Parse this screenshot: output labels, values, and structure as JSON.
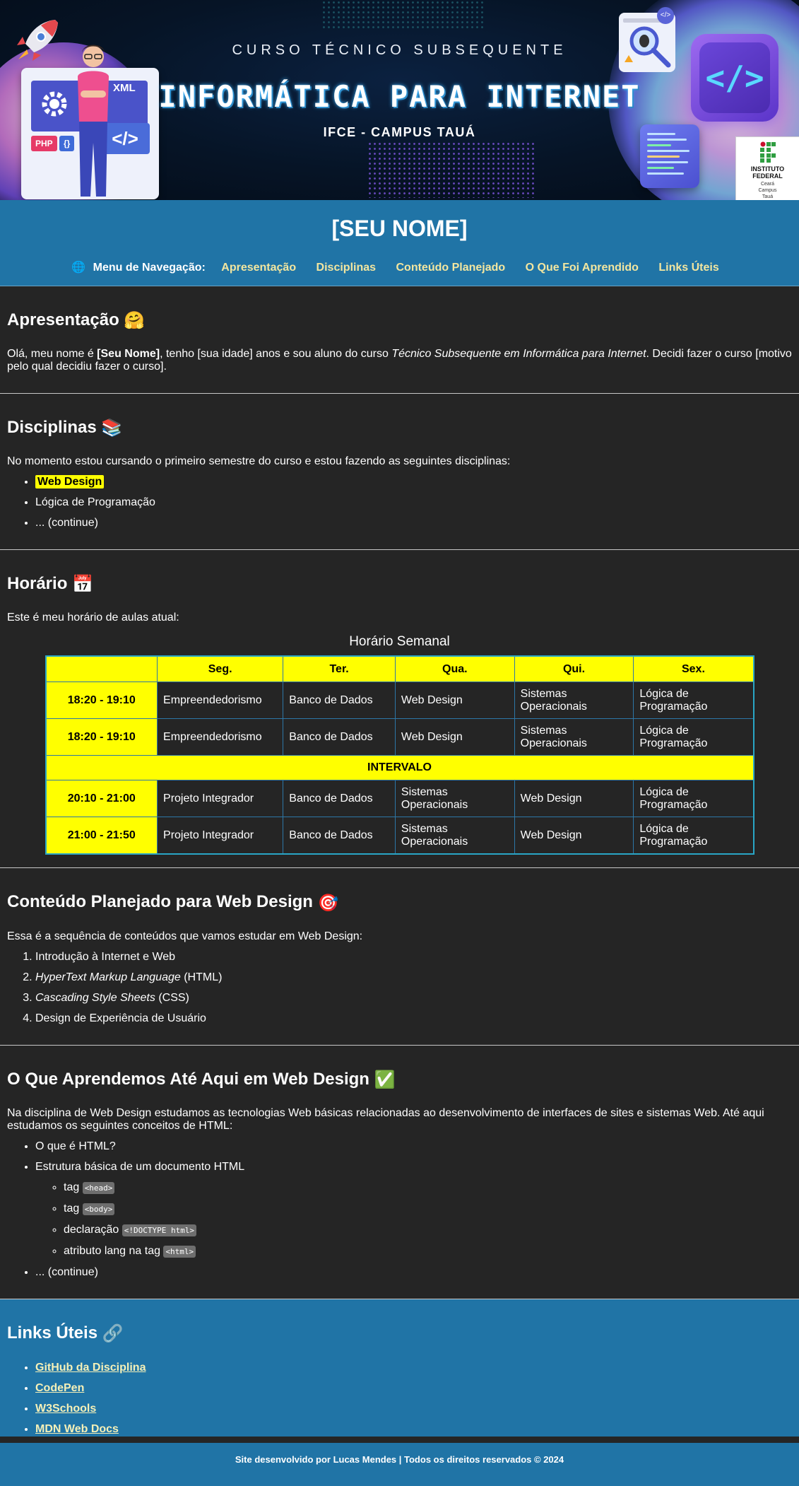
{
  "hero": {
    "subtitle": "CURSO TÉCNICO SUBSEQUENTE",
    "title": "INFORMÁTICA PARA INTERNET",
    "campus": "IFCE - CAMPUS TAUÁ",
    "board_xml": "XML",
    "board_php": "PHP",
    "board_braces": "{}",
    "board_code": "</>",
    "code_cube": "</>",
    "logo_line1": "INSTITUTO",
    "logo_line2": "FEDERAL",
    "logo_line3": "Ceará",
    "logo_line4": "Campus",
    "logo_line5": "Tauá"
  },
  "header": {
    "name": "[SEU NOME]",
    "nav_label": "Menu de Navegação:",
    "nav_items": [
      "Apresentação",
      "Disciplinas",
      "Conteúdo Planejado",
      "O Que Foi Aprendido",
      "Links Úteis"
    ]
  },
  "apresentacao": {
    "title": "Apresentação",
    "text_1": "Olá, meu nome é ",
    "name_bold": "[Seu Nome]",
    "text_2": ", tenho [sua idade] anos e sou aluno do curso ",
    "course_italic": "Técnico Subsequente em Informática para Internet",
    "text_3": ". Decidi fazer o curso [motivo pelo qual decidiu fazer o curso]."
  },
  "disciplinas": {
    "title": "Disciplinas",
    "intro": "No momento estou cursando o primeiro semestre do curso e estou fazendo as seguintes disciplinas:",
    "items": [
      "Web Design",
      "Lógica de Programação",
      "... (continue)"
    ]
  },
  "horario": {
    "title": "Horário",
    "intro": "Este é meu horário de aulas atual:",
    "caption": "Horário Semanal",
    "days": [
      "Seg.",
      "Ter.",
      "Qua.",
      "Qui.",
      "Sex."
    ],
    "rows": [
      {
        "time": "18:20 - 19:10",
        "cells": [
          "Empreendedorismo",
          "Banco de Dados",
          "Web Design",
          "Sistemas Operacionais",
          "Lógica de Programação"
        ]
      },
      {
        "time": "18:20 - 19:10",
        "cells": [
          "Empreendedorismo",
          "Banco de Dados",
          "Web Design",
          "Sistemas Operacionais",
          "Lógica de Programação"
        ]
      },
      {
        "time": "20:10 - 21:00",
        "cells": [
          "Projeto Integrador",
          "Banco de Dados",
          "Sistemas Operacionais",
          "Web Design",
          "Lógica de Programação"
        ]
      },
      {
        "time": "21:00 - 21:50",
        "cells": [
          "Projeto Integrador",
          "Banco de Dados",
          "Sistemas Operacionais",
          "Web Design",
          "Lógica de Programação"
        ]
      }
    ],
    "break_label": "INTERVALO"
  },
  "conteudo": {
    "title": "Conteúdo Planejado para Web Design",
    "intro": "Essa é a sequência de conteúdos que vamos estudar em Web Design:",
    "item_1": "Introdução à Internet e Web",
    "item_2_italic": "HyperText Markup Language",
    "item_2_rest": " (HTML)",
    "item_3_italic": "Cascading Style Sheets",
    "item_3_rest": " (CSS)",
    "item_4": "Design de Experiência de Usuário"
  },
  "aprendido": {
    "title": "O Que Aprendemos Até Aqui em Web Design",
    "intro": "Na disciplina de Web Design estudamos as tecnologias Web básicas relacionadas ao desenvolvimento de interfaces de sites e sistemas Web. Até aqui estudamos os seguintes conceitos de HTML:",
    "item_1": "O que é HTML?",
    "item_2": "Estrutura básica de um documento HTML",
    "sub_1_text": "tag ",
    "sub_1_code": "<head>",
    "sub_2_text": "tag ",
    "sub_2_code": "<body>",
    "sub_3_text": "declaração ",
    "sub_3_code": "<!DOCTYPE html>",
    "sub_4_text": "atributo lang na tag ",
    "sub_4_code": "<html>",
    "item_3": "... (continue)"
  },
  "links": {
    "title": "Links Úteis",
    "items": [
      "GitHub da Disciplina",
      "CodePen",
      "W3Schools",
      "MDN Web Docs"
    ]
  },
  "footer": {
    "text": "Site desenvolvido por Lucas Mendes | Todos os direitos reservados © 2024"
  },
  "colors": {
    "header_bg": "#2074a6",
    "page_bg": "#252525",
    "highlight": "#ffff00",
    "nav_link": "#f2e6a0"
  },
  "icons": {
    "apresentacao": "hugging-face-emoji",
    "disciplinas": "books-emoji",
    "horario": "calendar-emoji",
    "conteudo": "target-emoji",
    "aprendido": "check-mark-emoji",
    "links": "link-emoji",
    "nav": "globe-icon"
  }
}
